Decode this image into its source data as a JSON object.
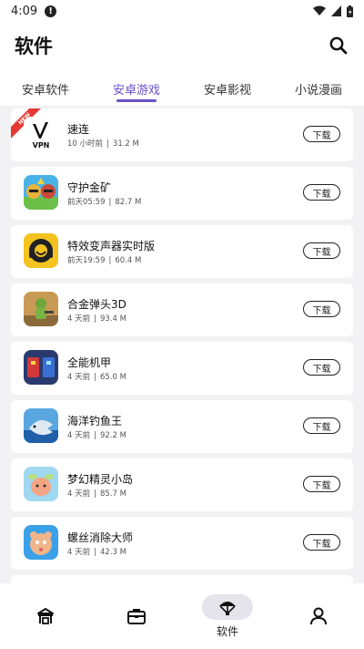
{
  "status_bar": {
    "time": "4:09"
  },
  "header": {
    "title": "软件"
  },
  "tabs": [
    "安卓软件",
    "安卓游戏",
    "安卓影视",
    "小说漫画"
  ],
  "active_tab": 1,
  "download_label": "下载",
  "apps": [
    {
      "name": "速连",
      "time": "10 小时前",
      "size": "31.2 M",
      "badge": "NEW",
      "icon": "vpn-icon"
    },
    {
      "name": "守护金矿",
      "time": "前天05:59",
      "size": "82.7 M",
      "icon": "mine-guard-icon"
    },
    {
      "name": "特效变声器实时版",
      "time": "前天19:59",
      "size": "60.4 M",
      "icon": "voice-changer-icon"
    },
    {
      "name": "合金弹头3D",
      "time": "4 天前",
      "size": "93.4 M",
      "icon": "metal-slug-icon"
    },
    {
      "name": "全能机甲",
      "time": "4 天前",
      "size": "65.0 M",
      "icon": "mecha-icon"
    },
    {
      "name": "海洋钓鱼王",
      "time": "4 天前",
      "size": "92.2 M",
      "icon": "fishing-icon"
    },
    {
      "name": "梦幻精灵小岛",
      "time": "4 天前",
      "size": "85.7 M",
      "icon": "fairy-island-icon"
    },
    {
      "name": "螺丝消除大师",
      "time": "4 天前",
      "size": "42.3 M",
      "icon": "screw-puzzle-icon"
    }
  ],
  "bottom_nav": [
    {
      "label": "",
      "icon": "home-stall-icon"
    },
    {
      "label": "",
      "icon": "briefcase-icon"
    },
    {
      "label": "软件",
      "icon": "parachute-icon",
      "active": true
    },
    {
      "label": "",
      "icon": "profile-icon"
    }
  ],
  "colors": {
    "accent": "#6a4fc8",
    "background": "#f2f2f4",
    "badge": "#e53935"
  }
}
